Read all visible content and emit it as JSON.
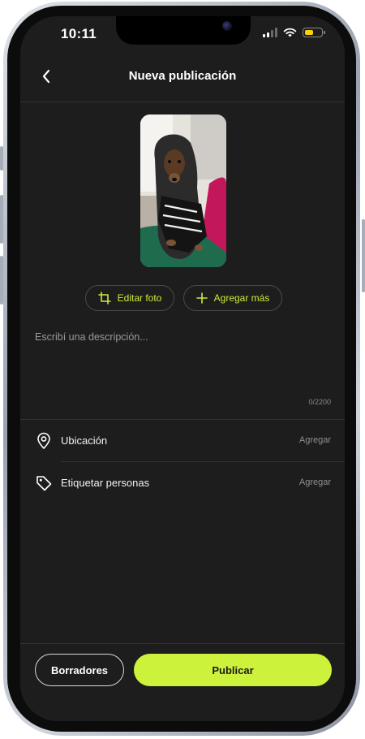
{
  "status_bar": {
    "time": "10:11",
    "battery_level": 0.5,
    "signal_bars": 2,
    "battery_color": "#f5d20c"
  },
  "header": {
    "title": "Nueva publicación",
    "back_icon": "chevron-left-icon"
  },
  "photo": {
    "description": "dog-photo"
  },
  "photo_actions": {
    "edit_label": "Editar foto",
    "edit_icon": "crop-icon",
    "add_label": "Agregar más",
    "add_icon": "plus-icon"
  },
  "description": {
    "placeholder": "Escribí una descripción...",
    "counter": "0/2200"
  },
  "options": [
    {
      "label": "Ubicación",
      "action": "Agregar",
      "icon": "location-pin-icon"
    },
    {
      "label": "Etiquetar personas",
      "action": "Agregar",
      "icon": "tag-icon"
    }
  ],
  "footer": {
    "drafts_label": "Borradores",
    "publish_label": "Publicar"
  },
  "colors": {
    "accent": "#cdf23c",
    "background": "#1d1d1d"
  }
}
